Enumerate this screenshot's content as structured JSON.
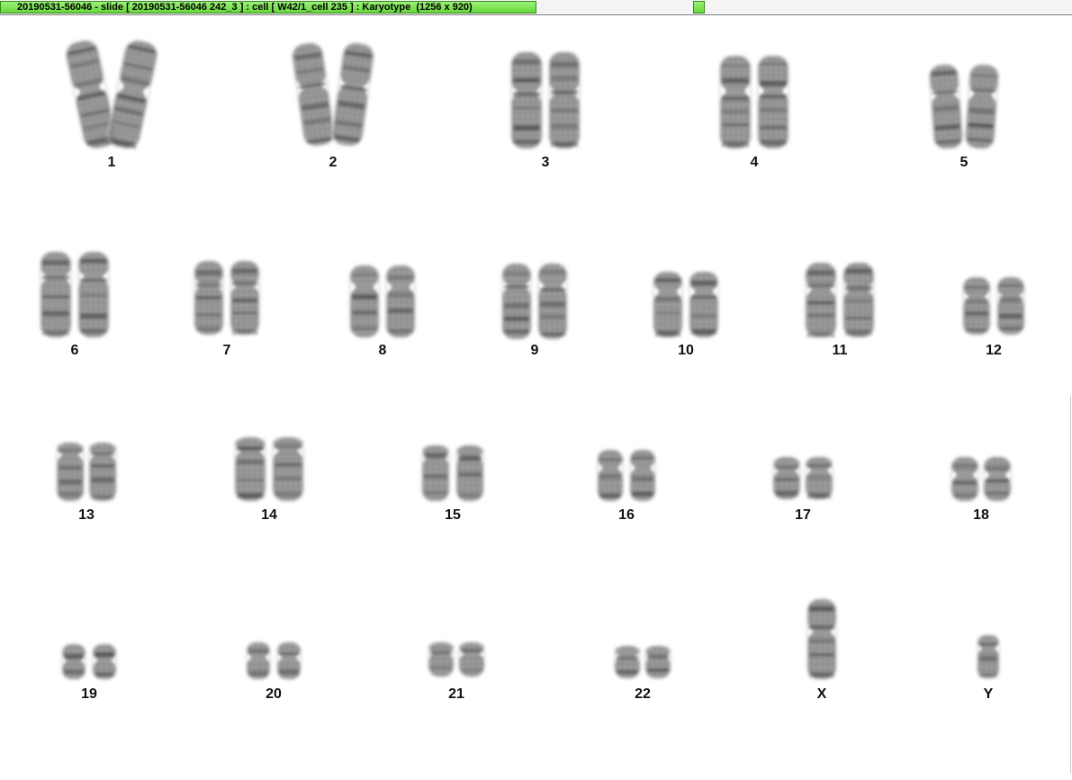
{
  "window": {
    "title": "20190531-56046 - slide [ 20190531-56046 242_3 ] : cell [ W42/1_cell 235 ] : Karyotype  (1256 x 920)",
    "accent_color": "#7ee25a"
  },
  "karyotype": {
    "chromosomes": [
      {
        "label": "1"
      },
      {
        "label": "2"
      },
      {
        "label": "3"
      },
      {
        "label": "4"
      },
      {
        "label": "5"
      },
      {
        "label": "6"
      },
      {
        "label": "7"
      },
      {
        "label": "8"
      },
      {
        "label": "9"
      },
      {
        "label": "10"
      },
      {
        "label": "11"
      },
      {
        "label": "12"
      },
      {
        "label": "13"
      },
      {
        "label": "14"
      },
      {
        "label": "15"
      },
      {
        "label": "16"
      },
      {
        "label": "17"
      },
      {
        "label": "18"
      },
      {
        "label": "19"
      },
      {
        "label": "20"
      },
      {
        "label": "21"
      },
      {
        "label": "22"
      },
      {
        "label": "X"
      },
      {
        "label": "Y"
      }
    ]
  }
}
